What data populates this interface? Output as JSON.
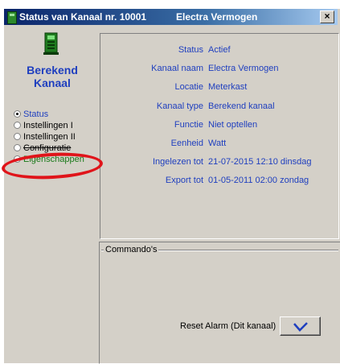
{
  "window": {
    "title": "Status van Kanaal nr. 10001",
    "subtitle": "Electra Vermogen",
    "close_glyph": "×"
  },
  "left": {
    "icon": "green-device-icon",
    "title": "Berekend Kanaal",
    "radios": [
      {
        "label": "Status",
        "selected": true
      },
      {
        "label": "Instellingen I",
        "selected": false
      },
      {
        "label": "Instellingen II",
        "selected": false
      },
      {
        "label": "Configuratie",
        "selected": false
      },
      {
        "label": "Eigenschappen",
        "selected": false
      }
    ]
  },
  "info": {
    "rows": [
      {
        "label": "Status",
        "value": "Actief"
      },
      {
        "label": "Kanaal naam",
        "value": "Electra Vermogen"
      },
      {
        "label": "Locatie",
        "value": "Meterkast"
      },
      {
        "label": "Kanaal type",
        "value": "Berekend kanaal"
      },
      {
        "label": "Functie",
        "value": "Niet optellen"
      },
      {
        "label": "Eenheid",
        "value": "Watt"
      },
      {
        "label": "Ingelezen tot",
        "value": "21-07-2015  12:10  dinsdag"
      },
      {
        "label": "Export tot",
        "value": "01-05-2011  02:00  zondag"
      }
    ]
  },
  "commands": {
    "title": "Commando's",
    "reset_label": "Reset Alarm (Dit kanaal)",
    "reset_icon": "check-icon"
  },
  "colors": {
    "title_bar": "#0a246a",
    "text_blue": "#1f3fbf",
    "highlight_ellipse": "#e0141a",
    "window_bg": "#d4d0c8"
  }
}
